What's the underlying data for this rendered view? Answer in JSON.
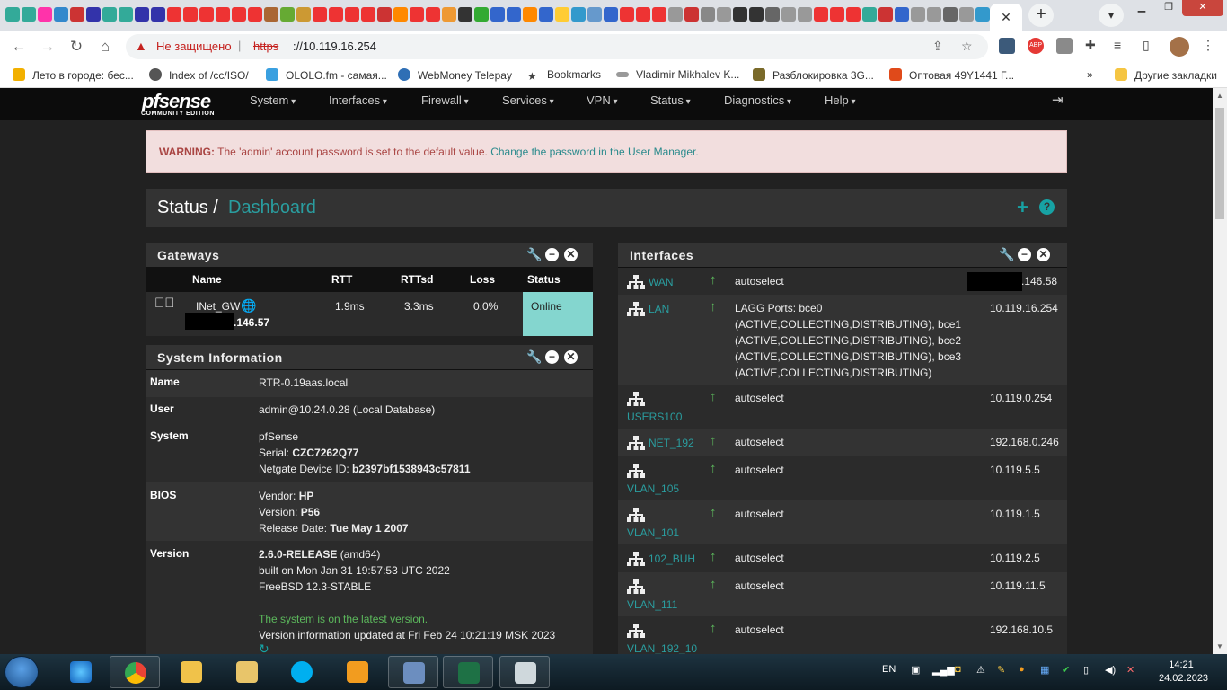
{
  "browser": {
    "active_tab_close": "✕",
    "new_tab": "+",
    "address": {
      "security_label": "Не защищено",
      "protocol": "https",
      "host": "://10.119.16.254"
    },
    "bookmarks": [
      {
        "label": "Лето в городе: бес...",
        "color": "#f2b000"
      },
      {
        "label": "Index of /cc/ISO/",
        "color": "#555555"
      },
      {
        "label": "OLOLO.fm - самая...",
        "color": "#3aa0e0"
      },
      {
        "label": "WebMoney Telepay",
        "color": "#2f6fb5"
      },
      {
        "label": "Bookmarks",
        "color": "#444444"
      },
      {
        "label": "Vladimir Mikhalev K...",
        "color": "#999999"
      },
      {
        "label": "Разблокировка 3G...",
        "color": "#7a6a2a"
      },
      {
        "label": "Оптовая 49Y1441 Г...",
        "color": "#e04a1a"
      }
    ],
    "more_bookmarks": "»",
    "other_bookmarks": "Другие закладки",
    "extensions": {
      "abp": "ABP"
    }
  },
  "nav": {
    "logo": "pfsense",
    "logo_sub": "COMMUNITY EDITION",
    "menus": [
      "System",
      "Interfaces",
      "Firewall",
      "Services",
      "VPN",
      "Status",
      "Diagnostics",
      "Help"
    ]
  },
  "alert": {
    "prefix": "WARNING:",
    "text": " The 'admin' account password is set to the default value. ",
    "link": "Change the password in the User Manager."
  },
  "breadcrumb": {
    "root": "Status",
    "separator": "/",
    "current": "Dashboard"
  },
  "gateways": {
    "title": "Gateways",
    "columns": [
      "Name",
      "RTT",
      "RTTsd",
      "Loss",
      "Status"
    ],
    "rows": [
      {
        "name": "INet_GW",
        "address": ".146.57",
        "rtt": "1.9ms",
        "rttsd": "3.3ms",
        "loss": "0.0%",
        "status": "Online"
      }
    ]
  },
  "sysinfo": {
    "title": "System Information",
    "name_label": "Name",
    "name_value": "RTR-0.19aas.local",
    "user_label": "User",
    "user_value": "admin@10.24.0.28 (Local Database)",
    "system_label": "System",
    "system_line1": "pfSense",
    "serial_label": "Serial: ",
    "serial_value": "CZC7262Q77",
    "device_label": "Netgate Device ID: ",
    "device_value": "b2397bf1538943c57811",
    "bios_label": "BIOS",
    "vendor_label": "Vendor: ",
    "vendor_value": "HP",
    "version_label": "Version: ",
    "version_value": "P56",
    "release_label": "Release Date: ",
    "release_value": "Tue May 1 2007",
    "ver_label": "Version",
    "ver_release": "2.6.0-RELEASE",
    "ver_arch": " (amd64)",
    "ver_built": "built on Mon Jan 31 19:57:53 UTC 2022",
    "ver_os": "FreeBSD 12.3-STABLE",
    "ver_latest": "The system is on the latest version.",
    "ver_updated": "Version information updated at Fri Feb 24 10:21:19 MSK 2023"
  },
  "interfaces": {
    "title": "Interfaces",
    "rows": [
      {
        "name": "WAN",
        "media": "autoselect",
        "ip": ".146.58"
      },
      {
        "name": "LAN",
        "media": "LAGG Ports: bce0",
        "media2": "(ACTIVE,COLLECTING,DISTRIBUTING), bce1",
        "media3": "(ACTIVE,COLLECTING,DISTRIBUTING), bce2",
        "media4": "(ACTIVE,COLLECTING,DISTRIBUTING), bce3",
        "media5": "(ACTIVE,COLLECTING,DISTRIBUTING)",
        "ip": "10.119.16.254"
      },
      {
        "name": "USERS100",
        "media": "autoselect",
        "ip": "10.119.0.254"
      },
      {
        "name": "NET_192",
        "media": "autoselect",
        "ip": "192.168.0.246"
      },
      {
        "name": "VLAN_105",
        "media": "autoselect",
        "ip": "10.119.5.5"
      },
      {
        "name": "VLAN_101",
        "media": "autoselect",
        "ip": "10.119.1.5"
      },
      {
        "name": "102_BUH",
        "media": "autoselect",
        "ip": "10.119.2.5"
      },
      {
        "name": "VLAN_111",
        "media": "autoselect",
        "ip": "10.119.11.5"
      },
      {
        "name": "VLAN_192_10",
        "media": "autoselect",
        "ip": "192.168.10.5"
      }
    ]
  },
  "taskbar": {
    "lang": "EN",
    "time": "14:21",
    "date": "24.02.2023"
  }
}
